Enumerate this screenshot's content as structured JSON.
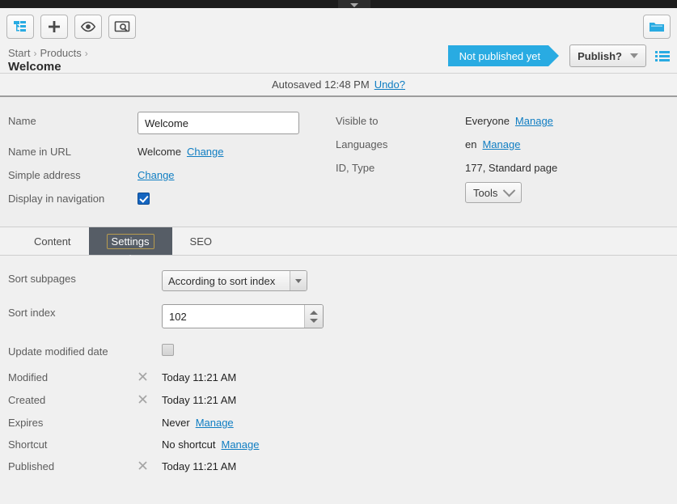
{
  "window": {
    "top_tab_icon": "chevron-down-icon"
  },
  "toolbar": {
    "buttons": [
      {
        "name": "page-tree-toggle",
        "icon": "tree-structure-icon"
      },
      {
        "name": "create-new",
        "icon": "plus-icon"
      },
      {
        "name": "toggle-view",
        "icon": "eye-icon"
      },
      {
        "name": "preview",
        "icon": "screen-search-icon"
      }
    ],
    "assets_button": {
      "name": "assets-pane-toggle",
      "icon": "folder-icon"
    }
  },
  "breadcrumb": {
    "items": [
      "Start",
      "Products"
    ],
    "separator": "›",
    "current": "Welcome"
  },
  "status": {
    "flag_label": "Not published yet",
    "flag_color": "#29abe2",
    "publish_label": "Publish?",
    "list_icon": "list-icon"
  },
  "autosave": {
    "text": "Autosaved 12:48 PM",
    "undo_label": "Undo?"
  },
  "info": {
    "left": [
      {
        "label": "Name",
        "value": "Welcome",
        "type": "input"
      },
      {
        "label": "Name in URL",
        "value": "Welcome",
        "link": "Change"
      },
      {
        "label": "Simple address",
        "value": "",
        "link": "Change"
      },
      {
        "label": "Display in navigation",
        "checked": true,
        "type": "checkbox"
      }
    ],
    "right": [
      {
        "label": "Visible to",
        "value": "Everyone",
        "link": "Manage"
      },
      {
        "label": "Languages",
        "value": "en",
        "link": "Manage"
      },
      {
        "label": "ID, Type",
        "value": "177, Standard page"
      }
    ],
    "tools_label": "Tools"
  },
  "tabs": [
    {
      "label": "Content",
      "active": false
    },
    {
      "label": "Settings",
      "active": true
    },
    {
      "label": "SEO",
      "active": false
    }
  ],
  "settings": {
    "sort_subpages": {
      "label": "Sort subpages",
      "value": "According to sort index"
    },
    "sort_index": {
      "label": "Sort index",
      "value": "102"
    },
    "update_modified_date": {
      "label": "Update modified date",
      "checked": false
    },
    "rows": [
      {
        "label": "Modified",
        "icon": "x-mark-icon",
        "value": "Today 11:21 AM",
        "link": ""
      },
      {
        "label": "Created",
        "icon": "x-mark-icon",
        "value": "Today 11:21 AM",
        "link": ""
      },
      {
        "label": "Expires",
        "icon": "",
        "value": "Never",
        "link": "Manage"
      },
      {
        "label": "Shortcut",
        "icon": "",
        "value": "No shortcut",
        "link": "Manage"
      },
      {
        "label": "Published",
        "icon": "x-mark-icon",
        "value": "Today 11:21 AM",
        "link": ""
      }
    ]
  }
}
